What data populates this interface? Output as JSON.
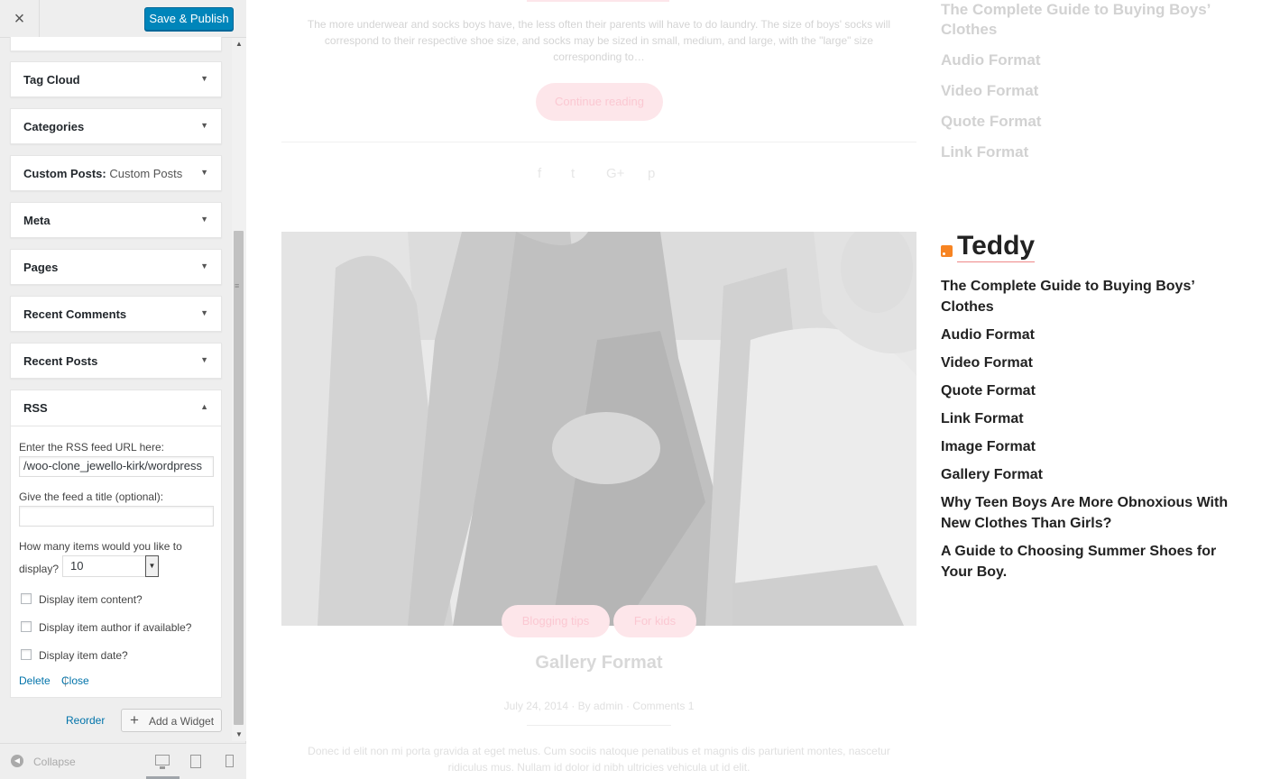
{
  "header": {
    "close_icon": "×",
    "publish_label": "Save & Publish"
  },
  "widgets": [
    {
      "title": "Tag Cloud",
      "subtitle": ""
    },
    {
      "title": "Categories",
      "subtitle": ""
    },
    {
      "title": "Custom Posts:",
      "subtitle": "Custom Posts"
    },
    {
      "title": "Meta",
      "subtitle": ""
    },
    {
      "title": "Pages",
      "subtitle": ""
    },
    {
      "title": "Recent Comments",
      "subtitle": ""
    },
    {
      "title": "Recent Posts",
      "subtitle": ""
    }
  ],
  "rss_widget": {
    "title": "RSS",
    "url_label": "Enter the RSS feed URL here:",
    "url_value": "woo-clone_jewello-kirk/wordpress/",
    "feed_title_label": "Give the feed a title (optional):",
    "feed_title_value": "",
    "items_label_line1": "How many items would you like to",
    "items_label_line2": "display?",
    "items_value": "10",
    "option_content": "Display item content?",
    "option_author": "Display item author if available?",
    "option_date": "Display item date?",
    "delete_label": "Delete",
    "separator": "|",
    "close_label": "Close"
  },
  "footer_actions": {
    "reorder_label": "Reorder",
    "add_widget_label": "Add a Widget",
    "collapse_label": "Collapse"
  },
  "preview": {
    "excerpt_top": "The more underwear and socks boys have, the less often their parents will have to do laundry. The size of boys' socks will correspond to their respective shoe size, and socks may be sized in small, medium, and large, with the \"large\" size corresponding to…",
    "continue_label": "Continue reading",
    "share_icons": [
      "f",
      "t",
      "G+",
      "p"
    ],
    "categories": [
      "Blogging tips",
      "For kids"
    ],
    "post_title": "Gallery Format",
    "post_meta": "July 24, 2014   ·   By admin   ·   Comments 1",
    "excerpt_bottom": "Donec id elit non mi porta gravida at eget metus. Cum sociis natoque penatibus et magnis dis parturient montes, nascetur ridiculus mus. Nullam id dolor id nibh ultricies vehicula ut id elit."
  },
  "top_list": [
    "The Complete Guide to Buying Boys’ Clothes",
    "Audio Format",
    "Video Format",
    "Quote Format",
    "Link Format"
  ],
  "rss_section": {
    "heading": "Teddy",
    "items": [
      "The Complete Guide to Buying Boys’ Clothes",
      "Audio Format",
      "Video Format",
      "Quote Format",
      "Link Format",
      "Image Format",
      "Gallery Format",
      "Why Teen Boys Are More Obnoxious With New Clothes Than Girls?",
      "A Guide to Choosing Summer Shoes for Your Boy."
    ]
  },
  "colors": {
    "primary_button": "#0085ba",
    "link": "#0073aa",
    "accent_pink": "#fde6ea",
    "rss_orange": "#f78422"
  }
}
